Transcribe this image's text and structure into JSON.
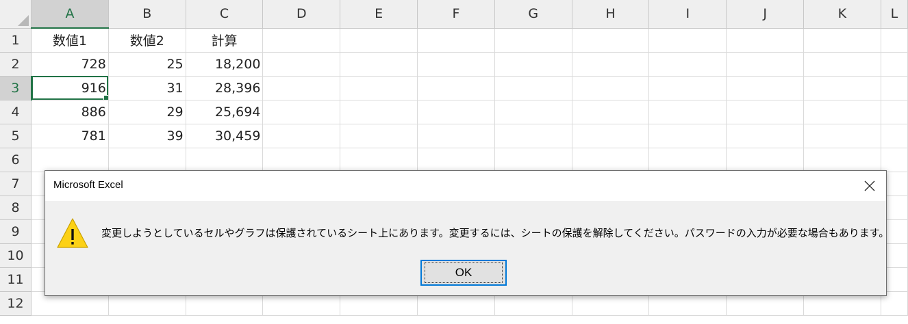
{
  "sheet": {
    "columns": [
      "A",
      "B",
      "C",
      "D",
      "E",
      "F",
      "G",
      "H",
      "I",
      "J",
      "K",
      "L"
    ],
    "rows": [
      "1",
      "2",
      "3",
      "4",
      "5",
      "6",
      "7",
      "8",
      "9",
      "10",
      "11",
      "12"
    ],
    "headers": [
      "数値1",
      "数値2",
      "計算"
    ],
    "data": [
      [
        "728",
        "25",
        "18,200"
      ],
      [
        "916",
        "31",
        "28,396"
      ],
      [
        "886",
        "29",
        "25,694"
      ],
      [
        "781",
        "39",
        "30,459"
      ]
    ],
    "active_cell": "A3",
    "accent_color": "#217346"
  },
  "dialog": {
    "title": "Microsoft Excel",
    "icon": "warning-icon",
    "message": "変更しようとしているセルやグラフは保護されているシート上にあります。変更するには、シートの保護を解除してください。パスワードの入力が必要な場合もあります。",
    "ok_label": "OK",
    "close_icon": "close-icon"
  }
}
